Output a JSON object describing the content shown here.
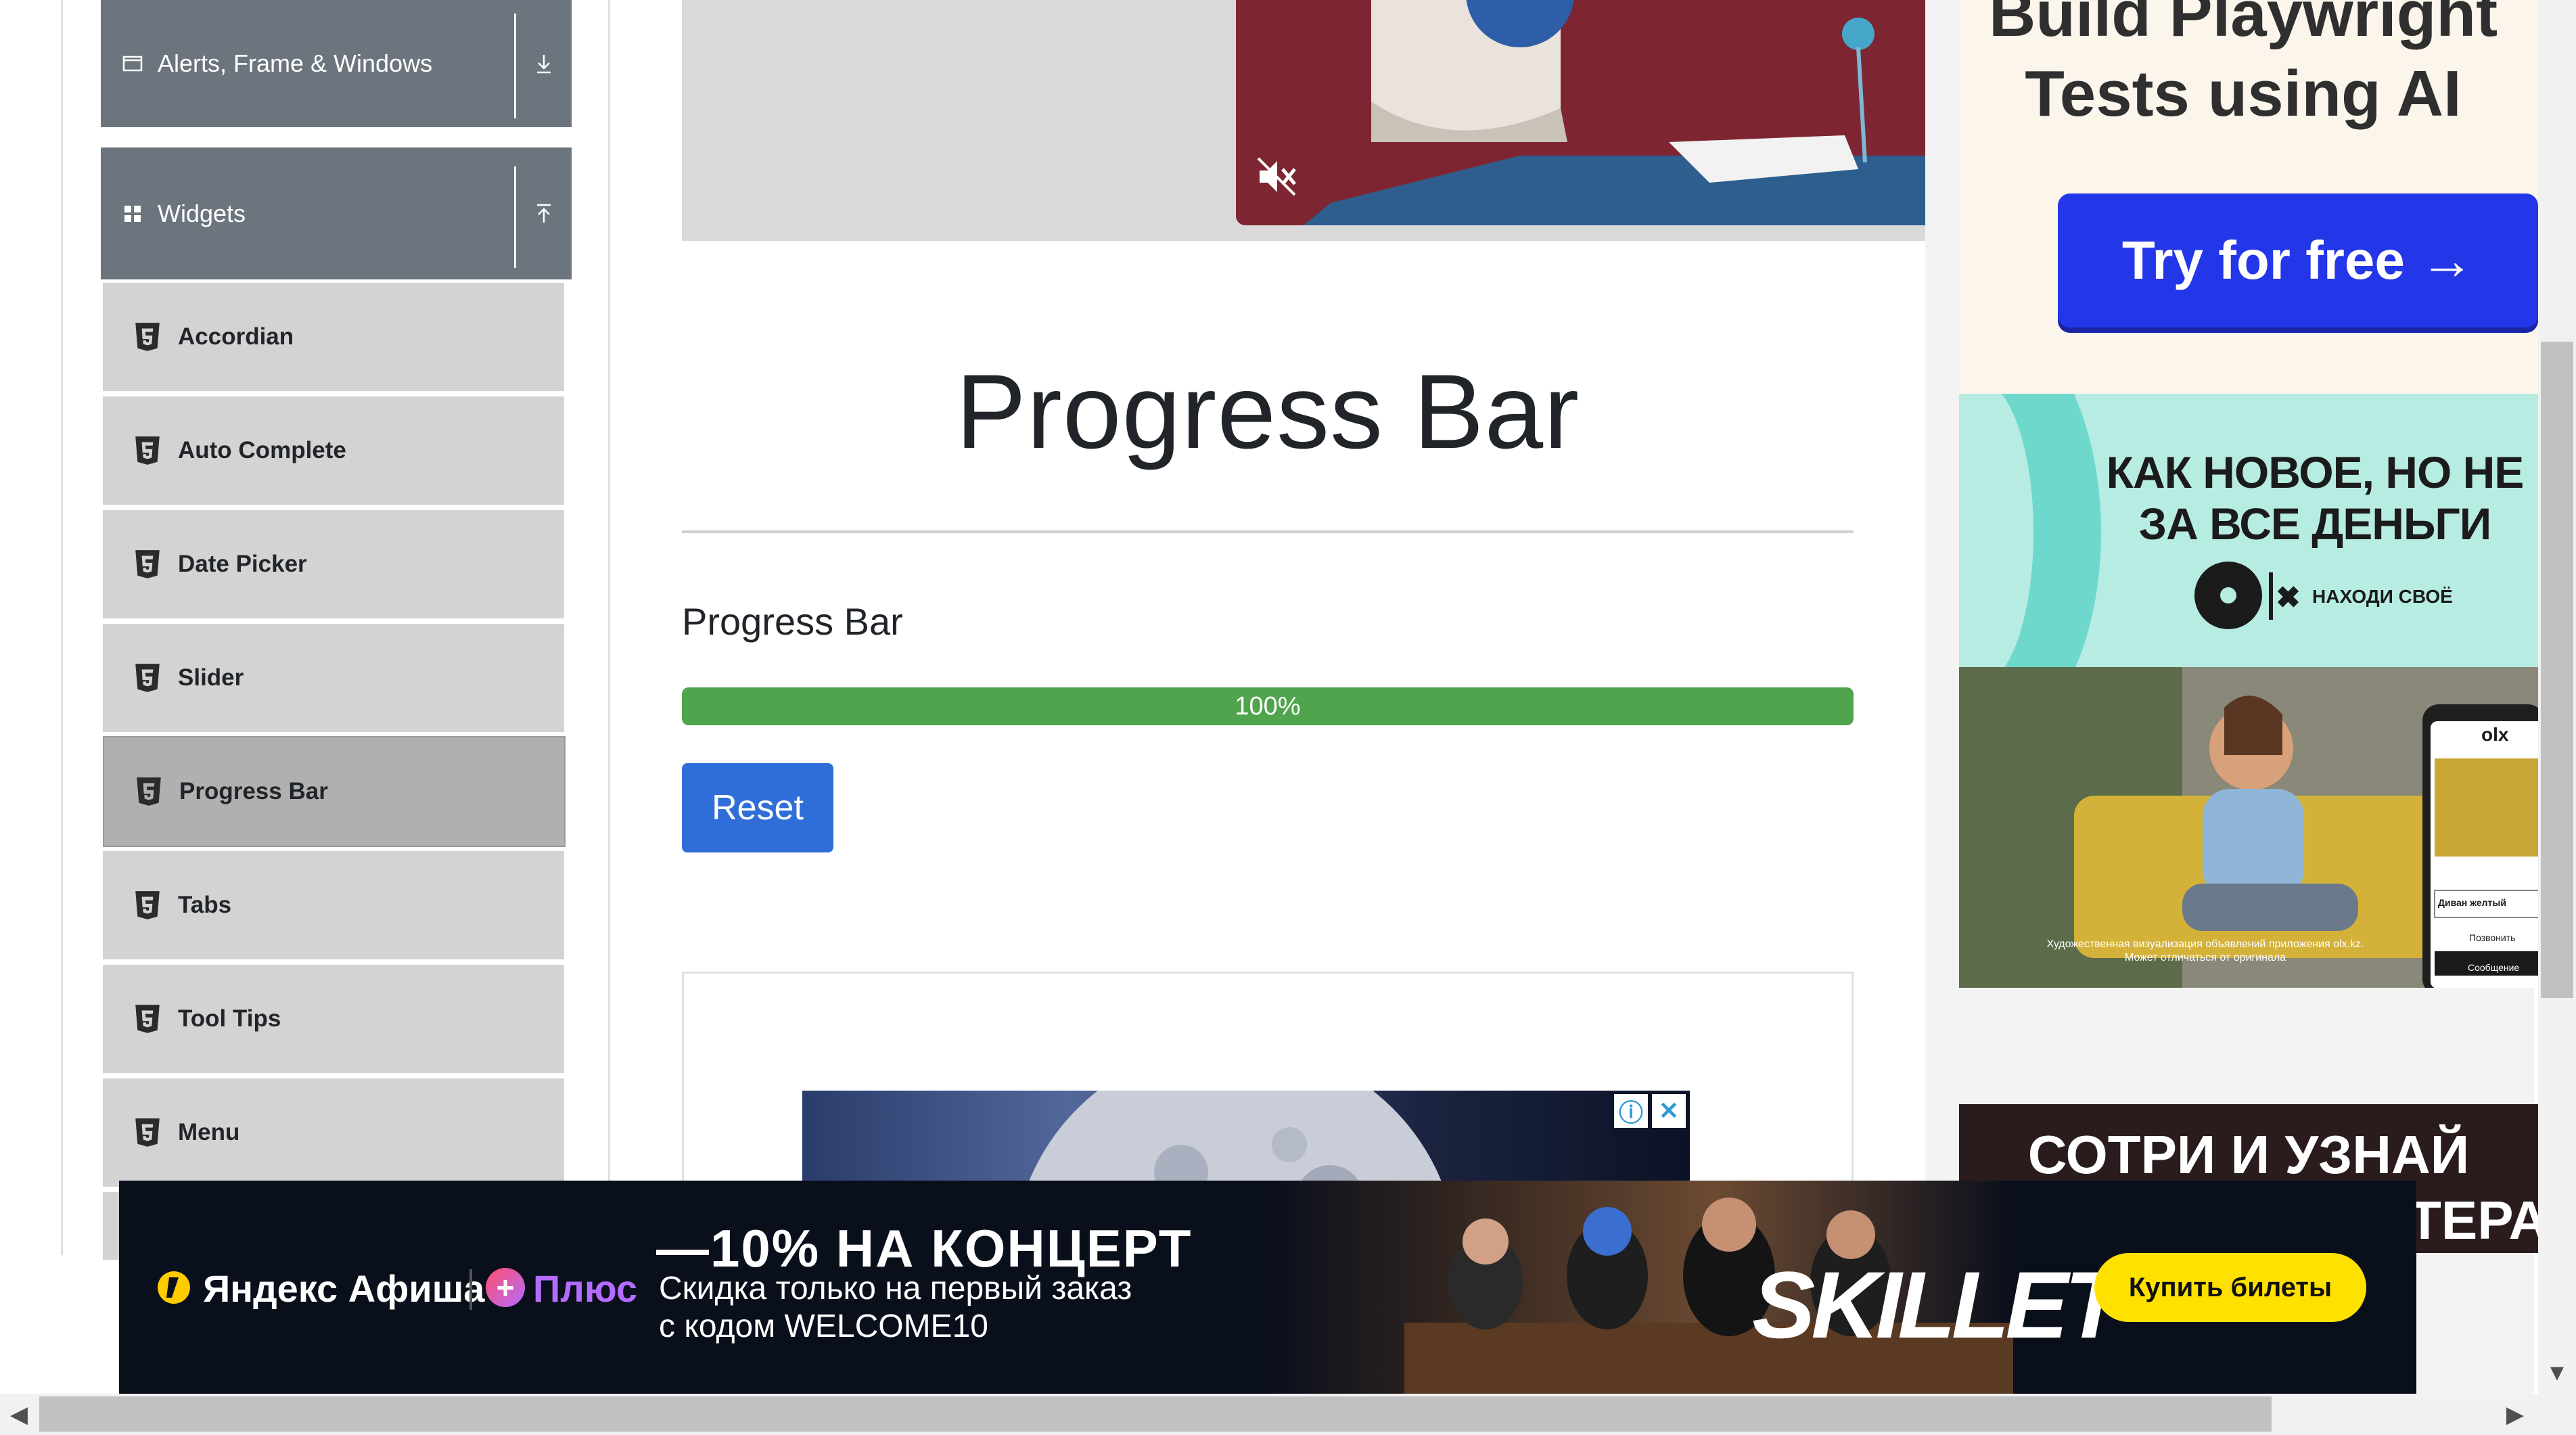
{
  "sidebar": {
    "groups": [
      {
        "label": "Alerts, Frame & Windows",
        "icon": "window-icon",
        "toggle_icon": "expand-icon"
      },
      {
        "label": "Widgets",
        "icon": "grid-icon",
        "toggle_icon": "collapse-icon"
      }
    ],
    "items": [
      {
        "label": "Accordian"
      },
      {
        "label": "Auto Complete"
      },
      {
        "label": "Date Picker"
      },
      {
        "label": "Slider"
      },
      {
        "label": "Progress Bar",
        "active": true
      },
      {
        "label": "Tabs"
      },
      {
        "label": "Tool Tips"
      },
      {
        "label": "Menu"
      }
    ]
  },
  "main": {
    "title": "Progress Bar",
    "section_label": "Progress Bar",
    "progress": {
      "value": 100,
      "label": "100%",
      "color": "#4fa44d"
    },
    "reset_label": "Reset",
    "video": {
      "mute_icon": "muted-speaker-icon"
    }
  },
  "ads": {
    "playwright": {
      "headline": "Build Playwright Tests using AI",
      "button": "Try for free →"
    },
    "olx": {
      "headline": "КАК НОВОЕ, НО НЕ ЗА ВСЕ ДЕНЬГИ",
      "tagline": "НАХОДИ СВОЁ",
      "logo": "olx",
      "disclaimer": "Художественная визуализация объявлений приложения olx.kz. Может отличаться от оригинала",
      "phone_item": "Диван желтый",
      "phone_call": "Позвонить",
      "phone_message": "Сообщение"
    },
    "secret": {
      "headline": "СОТРИ И УЗНАЙ СЕКРЕТ",
      "partial": "ТЕРА"
    },
    "banner": {
      "brand": "Яндекс Афиша",
      "plus": "Плюс",
      "headline": "—10% НА КОНЦЕРТ",
      "sub1": "Скидка только на первый заказ",
      "sub2": "с кодом WELCOME10",
      "band": "SKILLET",
      "button": "Купить билеты"
    }
  },
  "colors": {
    "sidebar_group": "#6c757d",
    "sidebar_item": "#d3d3d3",
    "reset_button": "#2f6ed8"
  }
}
